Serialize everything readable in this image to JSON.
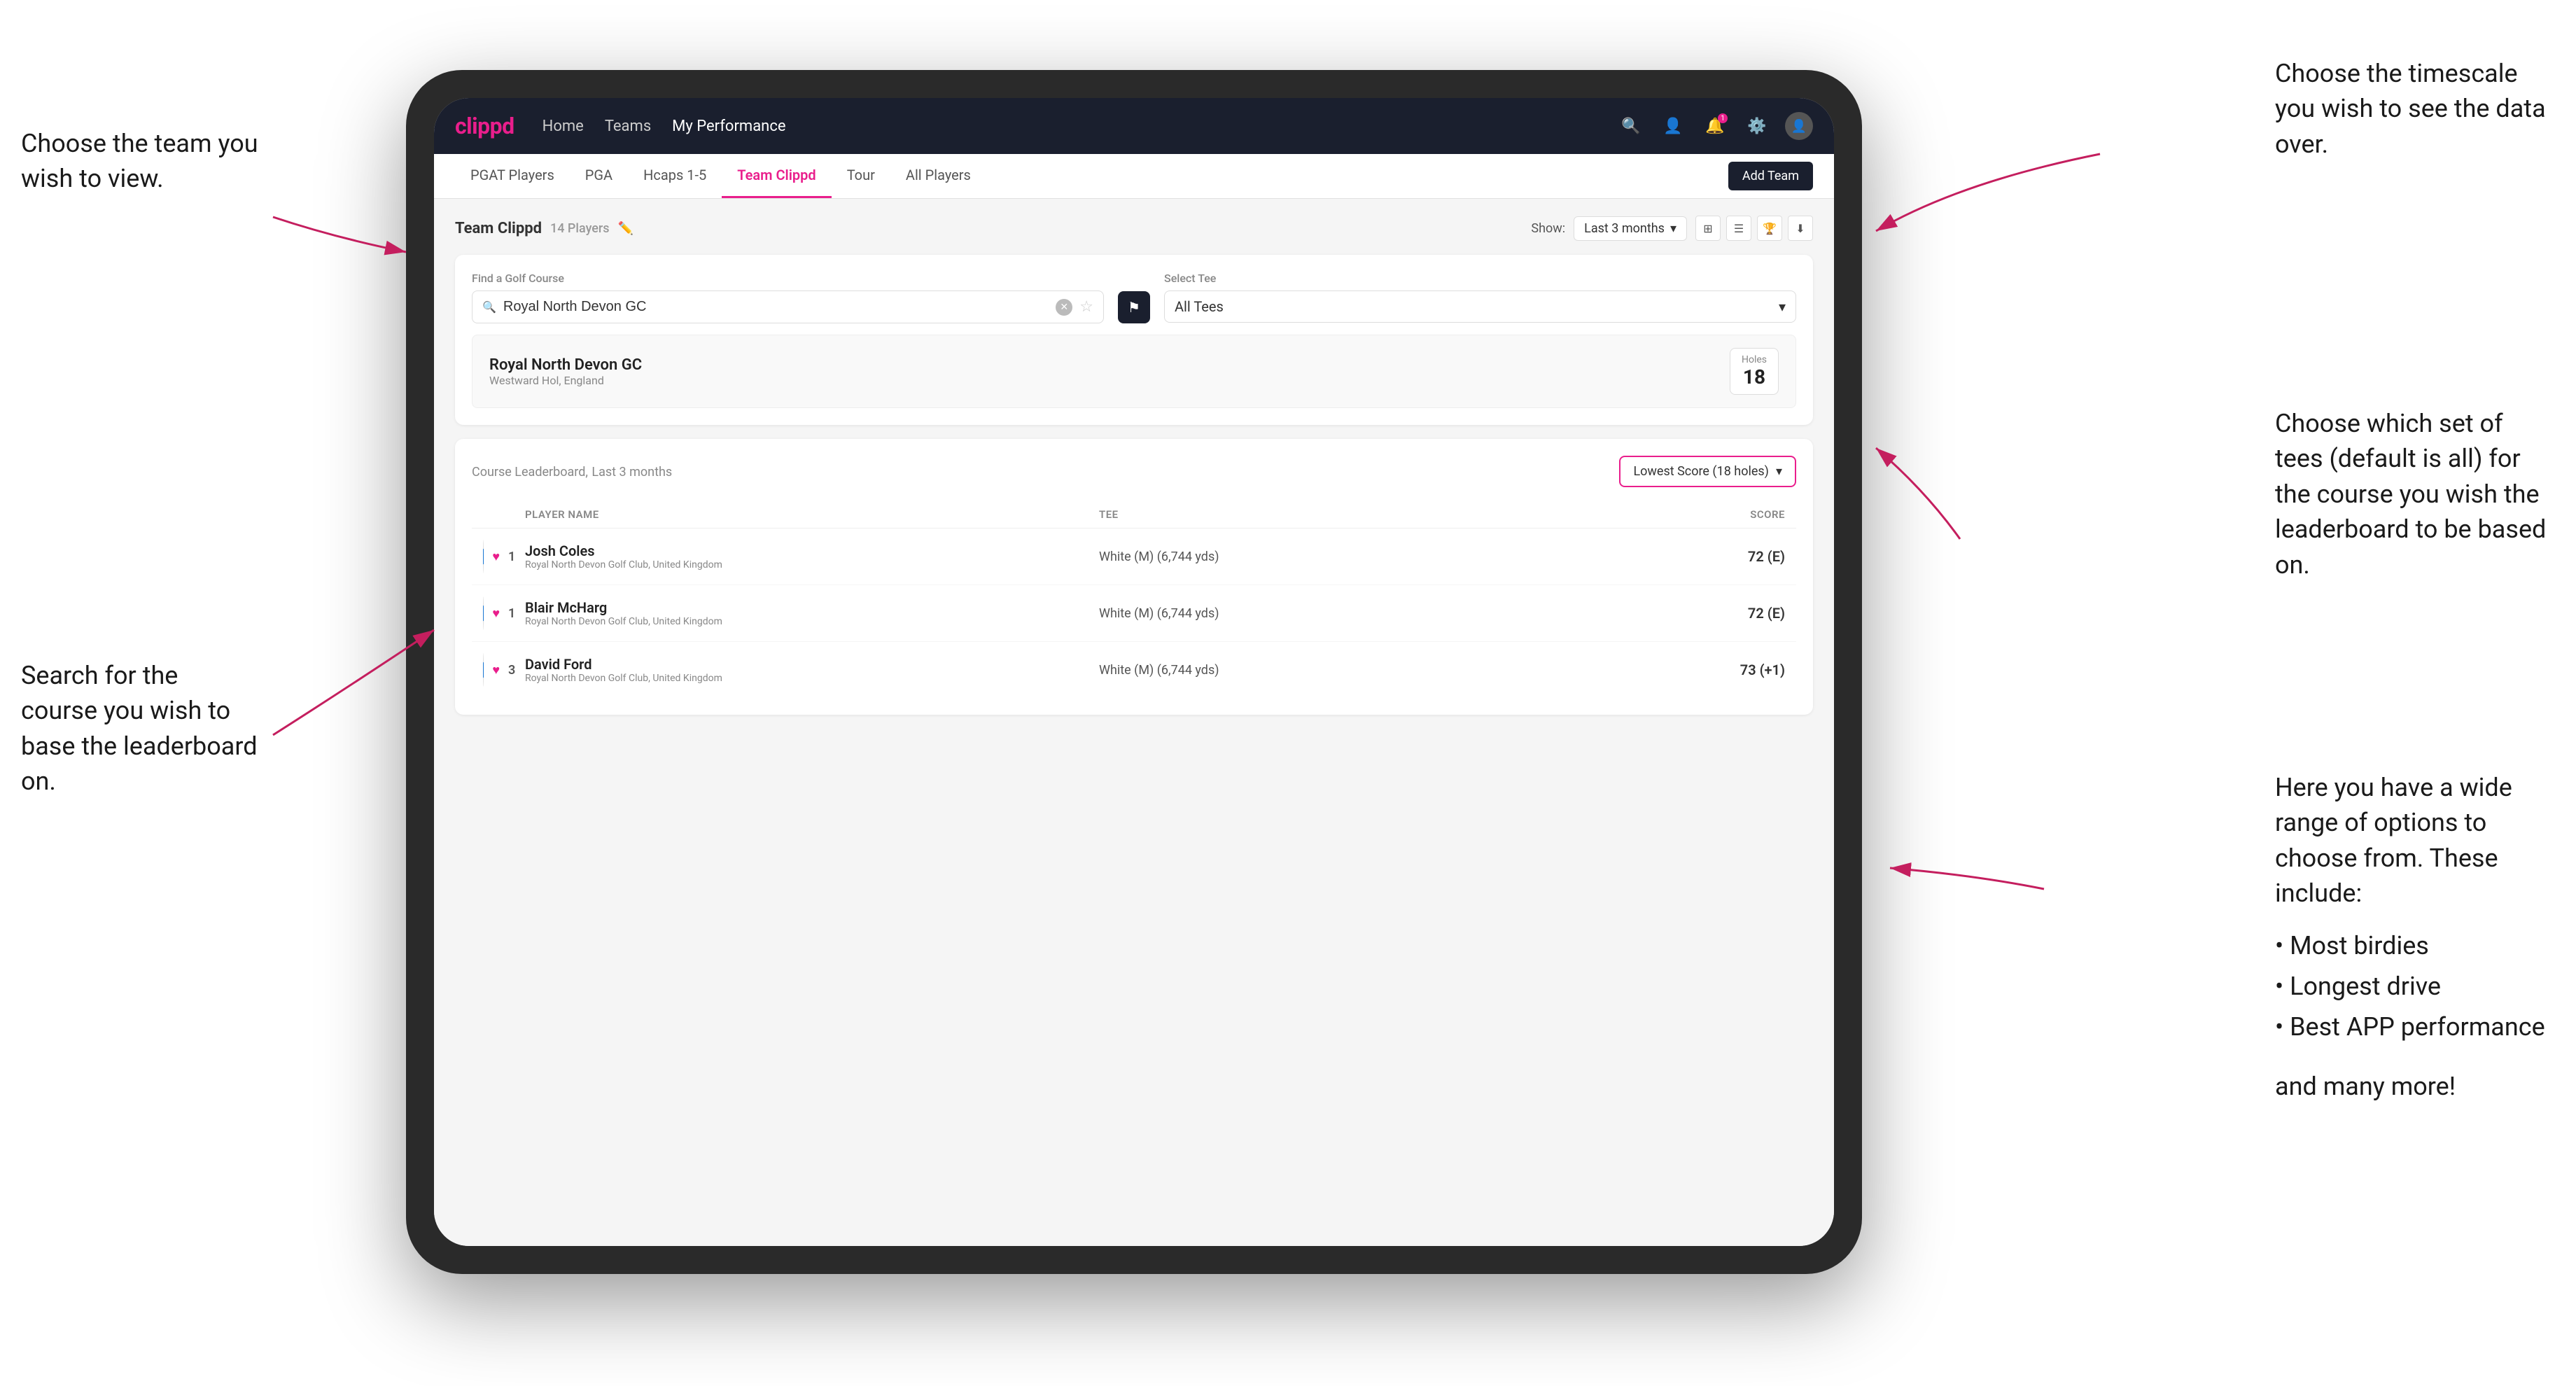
{
  "annotations": {
    "top_left": {
      "title": "Choose the team you wish to view."
    },
    "top_right": {
      "title": "Choose the timescale you wish to see the data over."
    },
    "middle_right": {
      "title": "Choose which set of tees (default is all) for the course you wish the leaderboard to be based on."
    },
    "bottom_left": {
      "title": "Search for the course you wish to base the leaderboard on."
    },
    "bottom_right_title": "Here you have a wide range of options to choose from. These include:",
    "bottom_right_list": [
      "Most birdies",
      "Longest drive",
      "Best APP performance"
    ],
    "bottom_right_footer": "and many more!"
  },
  "navbar": {
    "brand": "clippd",
    "links": [
      "Home",
      "Teams",
      "My Performance"
    ],
    "active_link": "My Performance"
  },
  "subnav": {
    "tabs": [
      "PGAT Players",
      "PGA",
      "Hcaps 1-5",
      "Team Clippd",
      "Tour",
      "All Players"
    ],
    "active_tab": "Team Clippd",
    "add_team_label": "Add Team"
  },
  "team_header": {
    "title": "Team Clippd",
    "player_count": "14 Players",
    "show_label": "Show:",
    "show_value": "Last 3 months"
  },
  "course_finder": {
    "find_label": "Find a Golf Course",
    "search_placeholder": "Royal North Devon GC",
    "select_tee_label": "Select Tee",
    "tee_value": "All Tees"
  },
  "course_result": {
    "name": "Royal North Devon GC",
    "location": "Westward Hol, England",
    "holes_label": "Holes",
    "holes_value": "18"
  },
  "leaderboard": {
    "title": "Course Leaderboard,",
    "subtitle": "Last 3 months",
    "score_type": "Lowest Score (18 holes)",
    "columns": {
      "player": "PLAYER NAME",
      "tee": "TEE",
      "score": "SCORE"
    },
    "rows": [
      {
        "rank": "1",
        "name": "Josh Coles",
        "club": "Royal North Devon Golf Club, United Kingdom",
        "tee": "White (M) (6,744 yds)",
        "score": "72 (E)"
      },
      {
        "rank": "1",
        "name": "Blair McHarg",
        "club": "Royal North Devon Golf Club, United Kingdom",
        "tee": "White (M) (6,744 yds)",
        "score": "72 (E)"
      },
      {
        "rank": "3",
        "name": "David Ford",
        "club": "Royal North Devon Golf Club, United Kingdom",
        "tee": "White (M) (6,744 yds)",
        "score": "73 (+1)"
      }
    ]
  }
}
